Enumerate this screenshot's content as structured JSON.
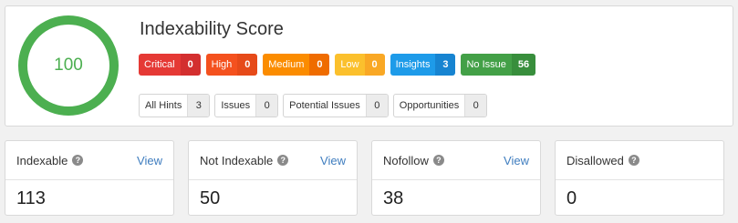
{
  "score": {
    "value": "100",
    "title": "Indexability Score",
    "gauge_color": "#4caf50"
  },
  "severity": [
    {
      "label": "Critical",
      "count": "0",
      "color": "#e53935"
    },
    {
      "label": "High",
      "count": "0",
      "color": "#f4511e"
    },
    {
      "label": "Medium",
      "count": "0",
      "color": "#fb8c00"
    },
    {
      "label": "Low",
      "count": "0",
      "color": "#fbc02d"
    },
    {
      "label": "Insights",
      "count": "3",
      "color": "#1e9be9"
    },
    {
      "label": "No Issue",
      "count": "56",
      "color": "#43a047"
    }
  ],
  "filters": [
    {
      "label": "All Hints",
      "count": "3"
    },
    {
      "label": "Issues",
      "count": "0"
    },
    {
      "label": "Potential Issues",
      "count": "0"
    },
    {
      "label": "Opportunities",
      "count": "0"
    }
  ],
  "cards": [
    {
      "label": "Indexable",
      "value": "113",
      "view": "View",
      "help_icon": "question-icon"
    },
    {
      "label": "Not Indexable",
      "value": "50",
      "view": "View",
      "help_icon": "question-icon"
    },
    {
      "label": "Nofollow",
      "value": "38",
      "view": "View",
      "help_icon": "question-icon"
    },
    {
      "label": "Disallowed",
      "value": "0",
      "view": "",
      "help_icon": "question-icon"
    }
  ]
}
